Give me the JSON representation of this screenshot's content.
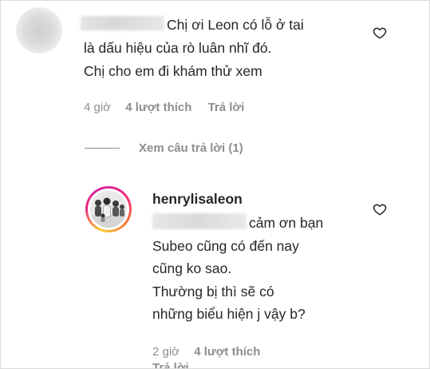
{
  "comment": {
    "text_lines": [
      "Chị ơi Leon có lỗ ở tai",
      "là dấu hiệu của rò luân nhĩ đó.",
      "Chị cho em đi khám thử xem"
    ],
    "time": "4 giờ",
    "likes": "4 lượt thích",
    "reply_label": "Trả lời",
    "view_replies": "Xem câu trả lời (1)",
    "like_icon": "heart-outline-icon"
  },
  "reply": {
    "username": "henrylisaleon",
    "text_lines": [
      "cảm ơn bạn",
      "Subeo cũng có đến nay",
      "cũng ko sao.",
      "Thường bị thì sẽ có",
      "những biểu hiện j vậy b?"
    ],
    "time": "2 giờ",
    "likes": "4 lượt thích",
    "reply_label": "Trả lời",
    "like_icon": "heart-outline-icon",
    "ring_colors": [
      "#f9ce34",
      "#ee2a7b",
      "#d6249f",
      "#f77737"
    ]
  }
}
